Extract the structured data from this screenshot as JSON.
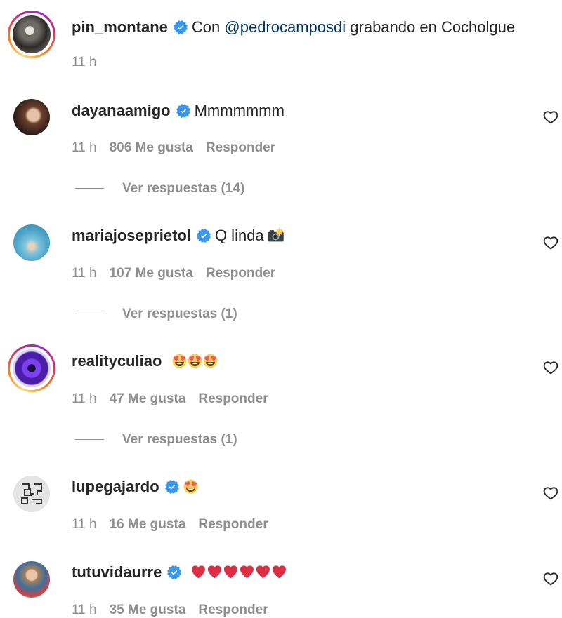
{
  "post": {
    "username": "pin_montane",
    "text_prefix": "Con ",
    "mention": "@pedrocamposdi",
    "text_suffix": " grabando en Cocholgue",
    "time": "11 h"
  },
  "comments": [
    {
      "username": "dayanaamigo",
      "text": "Mmmmmmm",
      "time": "11 h",
      "likes": "806 Me gusta",
      "reply": "Responder",
      "view_replies": "Ver respuestas (14)"
    },
    {
      "username": "mariajoseprietol",
      "text": "Q linda",
      "time": "11 h",
      "likes": "107 Me gusta",
      "reply": "Responder",
      "view_replies": "Ver respuestas (1)"
    },
    {
      "username": "realityculiao",
      "text": "😍😍😍",
      "time": "11 h",
      "likes": "47 Me gusta",
      "reply": "Responder",
      "view_replies": "Ver respuestas (1)"
    },
    {
      "username": "lupegajardo",
      "text": "😍",
      "time": "11 h",
      "likes": "16 Me gusta",
      "reply": "Responder"
    },
    {
      "username": "tutuvidaurre",
      "text": "❤️❤️❤️❤️❤️❤️",
      "time": "11 h",
      "likes": "35 Me gusta",
      "reply": "Responder"
    }
  ],
  "icons": {
    "verified": "verified-badge-icon",
    "like": "heart-outline-icon",
    "camera_emoji": "camera-flash-emoji",
    "heart_eyes_emoji": "heart-eyes-emoji",
    "red_heart_emoji": "red-heart-emoji"
  },
  "colors": {
    "verified_blue": "#3897f0",
    "mention": "#00376b",
    "secondary_text": "#8e8e8e",
    "primary_text": "#262626"
  }
}
